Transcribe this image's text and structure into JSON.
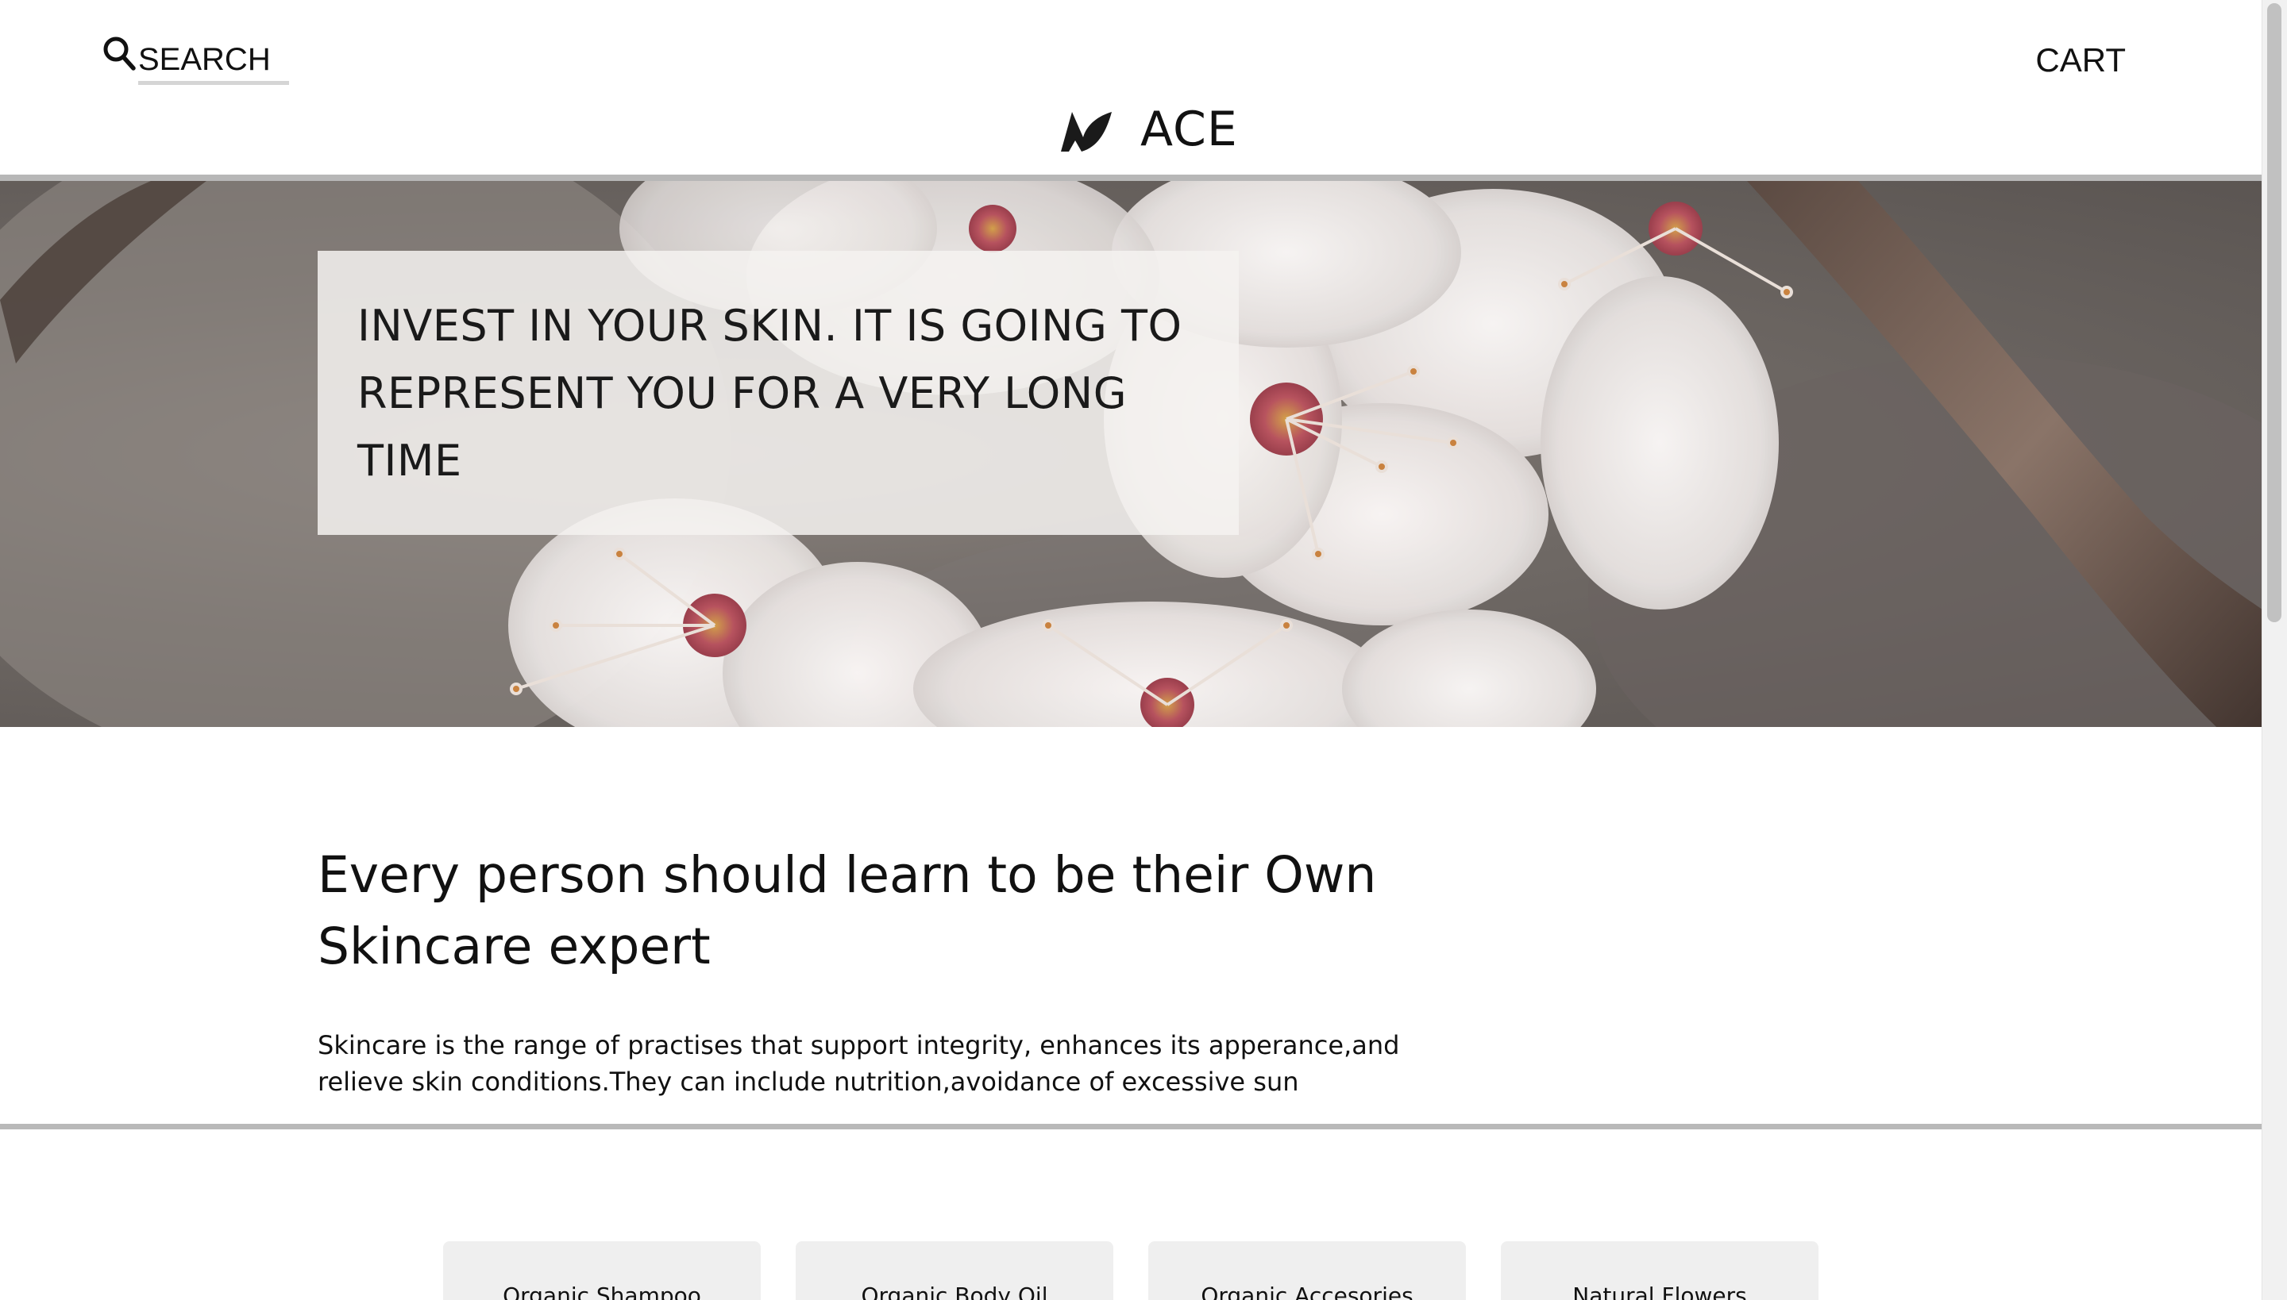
{
  "header": {
    "search_placeholder": "SEARCH",
    "cart_label": "CART",
    "brand_name": "ACE",
    "icons": {
      "search": "search-icon",
      "logo": "brand-logo-icon"
    }
  },
  "hero": {
    "heading": "INVEST IN YOUR SKIN. IT IS GOING TO REPRESENT YOU FOR A VERY LONG TIME"
  },
  "intro": {
    "title": "Every person should learn to be their Own Skincare expert",
    "text": "Skincare is the range of practises that support integrity, enhances its apperance,and relieve skin conditions.They can include nutrition,avoidance of excessive sun"
  },
  "categories": [
    {
      "label": "Organic Shampoo"
    },
    {
      "label": "Organic Body Oil"
    },
    {
      "label": "Organic Accesories"
    },
    {
      "label": "Natural Flowers"
    }
  ],
  "colors": {
    "card_background": "#efefef",
    "divider": "#b9b9b9",
    "text": "#111111"
  }
}
